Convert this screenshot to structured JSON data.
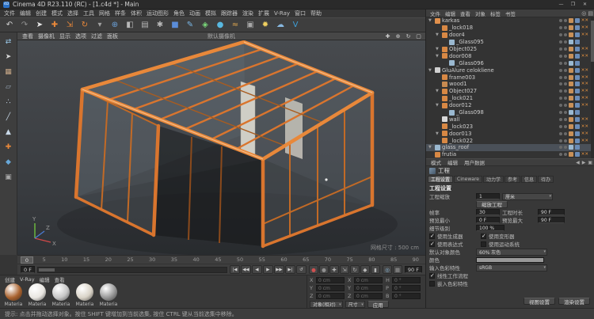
{
  "colors": {
    "accent": "#e8883a",
    "frame": "#d9752e",
    "frame_light": "#f8c89a",
    "panel": "#383838"
  },
  "title_bar": {
    "app_icon": "4D",
    "title": "Cinema 4D R23.110 (RC) - [1.c4d *] - Main",
    "minimize": "—",
    "maximize": "❐",
    "close": "✕"
  },
  "menu_bar": {
    "items": [
      "文件",
      "编辑",
      "创建",
      "模式",
      "选择",
      "工具",
      "网格",
      "样条",
      "体积",
      "运动图形",
      "角色",
      "动画",
      "模拟",
      "跟踪器",
      "渲染",
      "扩展",
      "V-Ray",
      "窗口",
      "帮助"
    ]
  },
  "toolbar": {
    "icons": [
      {
        "name": "undo-button",
        "glyph": "↶",
        "color": "#d0d0d0"
      },
      {
        "name": "redo-button",
        "glyph": "↷",
        "color": "#8f8f8f"
      },
      {
        "name": "live-selection-tool",
        "glyph": "➤",
        "color": "#e8e8e8"
      },
      {
        "name": "move-tool",
        "glyph": "✚",
        "color": "#e8883a"
      },
      {
        "name": "scale-tool",
        "glyph": "⇲",
        "color": "#e8883a"
      },
      {
        "name": "rotate-tool",
        "glyph": "↻",
        "color": "#e8883a"
      },
      {
        "name": "last-tool",
        "glyph": "▾",
        "color": "#a0a0a0"
      },
      {
        "name": "coordinate-system-toggle",
        "glyph": "⊕",
        "color": "#6aa0d8"
      },
      {
        "name": "render-view-button",
        "glyph": "◧",
        "color": "#b8b8b8"
      },
      {
        "name": "render-picture-viewer-button",
        "glyph": "▤",
        "color": "#b8b8b8"
      },
      {
        "name": "render-settings-button",
        "glyph": "✱",
        "color": "#b8b8b8"
      },
      {
        "name": "add-cube-button",
        "glyph": "■",
        "color": "#5b8dd9"
      },
      {
        "name": "add-spline-button",
        "glyph": "✎",
        "color": "#7ab8e8"
      },
      {
        "name": "mograph-menu-button",
        "glyph": "◈",
        "color": "#7ad87a"
      },
      {
        "name": "volume-menu-button",
        "glyph": "●",
        "color": "#58b8e0"
      },
      {
        "name": "simulate-menu-button",
        "glyph": "≈",
        "color": "#e0a850"
      },
      {
        "name": "add-camera-button",
        "glyph": "▣",
        "color": "#a8a8a8"
      },
      {
        "name": "add-light-button",
        "glyph": "✹",
        "color": "#f0d060"
      },
      {
        "name": "add-sky-button",
        "glyph": "☁",
        "color": "#88b8e0"
      },
      {
        "name": "vray-button",
        "glyph": "V",
        "color": "#3f9fd8"
      }
    ]
  },
  "left_toolbar": {
    "icons": [
      {
        "name": "make-editable-button",
        "glyph": "⇄",
        "color": "#9ac8e8"
      },
      {
        "name": "model-mode-button",
        "glyph": "➤",
        "color": "#d8d8d8"
      },
      {
        "name": "texture-mode-button",
        "glyph": "▦",
        "color": "#c8a888"
      },
      {
        "name": "workplane-mode-button",
        "glyph": "▱",
        "color": "#98a8b8"
      },
      {
        "name": "points-mode-button",
        "glyph": "∴",
        "color": "#c8d8e8"
      },
      {
        "name": "edges-mode-button",
        "glyph": "╱",
        "color": "#c8d8e8"
      },
      {
        "name": "polygons-mode-button",
        "glyph": "▲",
        "color": "#c8d8e8"
      },
      {
        "name": "enable-axis-button",
        "glyph": "✚",
        "color": "#e8883a"
      },
      {
        "name": "snap-toggle-button",
        "glyph": "◆",
        "color": "#68a8d8"
      },
      {
        "name": "lock-workplane-button",
        "glyph": "▣",
        "color": "#a8a8a8"
      }
    ]
  },
  "viewport": {
    "menus": [
      "查看",
      "摄像机",
      "显示",
      "选项",
      "过滤",
      "面板"
    ],
    "view_label": "默认摄像机",
    "nav_icons": [
      {
        "name": "pan-view-icon",
        "glyph": "✚"
      },
      {
        "name": "zoom-view-icon",
        "glyph": "⊕"
      },
      {
        "name": "rotate-view-icon",
        "glyph": "↻"
      },
      {
        "name": "toggle-view-icon",
        "glyph": "▢"
      }
    ],
    "grid_label": "网格尺寸 : 500 cm",
    "axis_labels": {
      "x": "X",
      "y": "Y",
      "z": "Z"
    }
  },
  "timeline": {
    "marker": "0",
    "ticks": [
      "0",
      "5",
      "10",
      "15",
      "20",
      "25",
      "30",
      "35",
      "40",
      "45",
      "50",
      "55",
      "60",
      "65",
      "70",
      "75",
      "80",
      "85",
      "90"
    ]
  },
  "transport": {
    "current_frame": "0 F",
    "end_frame": "90 F",
    "buttons": [
      {
        "name": "goto-start-button",
        "glyph": "|◀"
      },
      {
        "name": "prev-key-button",
        "glyph": "◀◀"
      },
      {
        "name": "prev-frame-button",
        "glyph": "◀"
      },
      {
        "name": "play-button",
        "glyph": "▶"
      },
      {
        "name": "next-frame-button",
        "glyph": "▶▶"
      },
      {
        "name": "next-key-button",
        "glyph": "▶|"
      },
      {
        "name": "loop-button",
        "glyph": "↺"
      }
    ],
    "record_buttons": [
      {
        "name": "record-keyframe-button",
        "glyph": "●",
        "color": "#d05050"
      },
      {
        "name": "autokey-toggle-button",
        "glyph": "●",
        "color": "#909090"
      },
      {
        "name": "record-position-toggle",
        "glyph": "✚",
        "color": "#b8b8b8"
      },
      {
        "name": "record-scale-toggle",
        "glyph": "⇲",
        "color": "#b8b8b8"
      },
      {
        "name": "record-rotation-toggle",
        "glyph": "↻",
        "color": "#b8b8b8"
      },
      {
        "name": "record-parameter-toggle",
        "glyph": "◆",
        "color": "#b8b8b8"
      },
      {
        "name": "record-pla-toggle",
        "glyph": "▮",
        "color": "#b8b8b8"
      }
    ],
    "misc_buttons": [
      {
        "name": "solo-toggle-button",
        "glyph": "◎",
        "color": "#88b8d8"
      },
      {
        "name": "timeline-options-button",
        "glyph": "▦",
        "color": "#9a9a9a"
      }
    ]
  },
  "materials": {
    "menus": [
      "创建",
      "V-Ray",
      "编辑",
      "查看"
    ],
    "items": [
      {
        "name": "Materia",
        "color": "#a9622e"
      },
      {
        "name": "Materia",
        "color": "#e9e6e1"
      },
      {
        "name": "Materia",
        "color": "#c6c6c6"
      },
      {
        "name": "Materia",
        "color": "#d9d3c7"
      },
      {
        "name": "Materia",
        "color": "#979797"
      }
    ]
  },
  "coordinates": {
    "pos": {
      "x_label": "X",
      "x": "0 cm",
      "y_label": "Y",
      "y": "0 cm",
      "z_label": "Z",
      "z": "0 cm"
    },
    "size": {
      "x_label": "X",
      "x": "0 cm",
      "y_label": "Y",
      "y": "0 cm",
      "z_label": "Z",
      "z": "0 cm"
    },
    "rot": {
      "h_label": "H",
      "h": "0 °",
      "p_label": "P",
      "p": "0 °",
      "b_label": "B",
      "b": "0 °"
    },
    "mode": "对象(相对)",
    "size_mode": "尺寸",
    "apply": "应用"
  },
  "object_manager": {
    "menus": [
      "文件",
      "编辑",
      "查看",
      "对象",
      "标签",
      "书签"
    ],
    "menu_icons": [
      {
        "name": "om-search-icon",
        "glyph": "◎"
      },
      {
        "name": "om-filter-icon",
        "glyph": "▤"
      }
    ],
    "objects": [
      {
        "name": "karkas",
        "indent": 0,
        "caret": true,
        "icon": "#e0904c",
        "tag1": "#c89058",
        "tag2": "#6a8cb8",
        "x": true,
        "selected": false
      },
      {
        "name": "_lock018",
        "indent": 1,
        "caret": false,
        "icon": "#d88844",
        "tag1": "#c89058",
        "tag2": "#6a8cb8",
        "x": true,
        "selected": false
      },
      {
        "name": "door4",
        "indent": 1,
        "caret": true,
        "icon": "#d88844",
        "tag1": "#c89058",
        "tag2": "#6a8cb8",
        "x": true,
        "selected": false
      },
      {
        "name": "_Glass095",
        "indent": 2,
        "caret": false,
        "icon": "#9ab8d0",
        "tag1": "#9ab8d0",
        "tag2": "#6a8cb8",
        "x": false,
        "selected": false
      },
      {
        "name": "Object025",
        "indent": 1,
        "caret": true,
        "icon": "#d88844",
        "tag1": "#c89058",
        "tag2": "#6a8cb8",
        "x": true,
        "selected": false
      },
      {
        "name": "door008",
        "indent": 1,
        "caret": true,
        "icon": "#d88844",
        "tag1": "#c89058",
        "tag2": "#6a8cb8",
        "x": true,
        "selected": false
      },
      {
        "name": "_Glass096",
        "indent": 2,
        "caret": false,
        "icon": "#9ab8d0",
        "tag1": "#9ab8d0",
        "tag2": "#6a8cb8",
        "x": false,
        "selected": false
      },
      {
        "name": "GluAlure celokliene",
        "indent": 0,
        "caret": true,
        "icon": "#d0d0d0",
        "tag1": "#c89058",
        "tag2": "#6a8cb8",
        "x": true,
        "selected": false
      },
      {
        "name": "frame003",
        "indent": 1,
        "caret": false,
        "icon": "#d88844",
        "tag1": "#c89058",
        "tag2": "#6a8cb8",
        "x": true,
        "selected": false
      },
      {
        "name": "wood1",
        "indent": 1,
        "caret": false,
        "icon": "#c88a50",
        "tag1": "#c89058",
        "tag2": "#6a8cb8",
        "x": true,
        "selected": false
      },
      {
        "name": "Object027",
        "indent": 1,
        "caret": true,
        "icon": "#d88844",
        "tag1": "#c89058",
        "tag2": "#6a8cb8",
        "x": true,
        "selected": false
      },
      {
        "name": "_lock021",
        "indent": 1,
        "caret": false,
        "icon": "#d88844",
        "tag1": "#c89058",
        "tag2": "#6a8cb8",
        "x": true,
        "selected": false
      },
      {
        "name": "door012",
        "indent": 1,
        "caret": true,
        "icon": "#d88844",
        "tag1": "#c89058",
        "tag2": "#6a8cb8",
        "x": true,
        "selected": false
      },
      {
        "name": "_Glass098",
        "indent": 2,
        "caret": false,
        "icon": "#9ab8d0",
        "tag1": "#9ab8d0",
        "tag2": "#6a8cb8",
        "x": false,
        "selected": false
      },
      {
        "name": "wall",
        "indent": 1,
        "caret": false,
        "icon": "#d8d8d8",
        "tag1": "#c89058",
        "tag2": "#6a8cb8",
        "x": true,
        "selected": false
      },
      {
        "name": "_lock023",
        "indent": 1,
        "caret": false,
        "icon": "#d88844",
        "tag1": "#c89058",
        "tag2": "#6a8cb8",
        "x": true,
        "selected": false
      },
      {
        "name": "door013",
        "indent": 1,
        "caret": true,
        "icon": "#d88844",
        "tag1": "#c89058",
        "tag2": "#6a8cb8",
        "x": true,
        "selected": false
      },
      {
        "name": "_lock022",
        "indent": 1,
        "caret": false,
        "icon": "#d88844",
        "tag1": "#c89058",
        "tag2": "#6a8cb8",
        "x": true,
        "selected": false
      },
      {
        "name": "glass_roof",
        "indent": 0,
        "caret": true,
        "icon": "#9ab8d0",
        "tag1": "#9ab8d0",
        "tag2": "#6a8cb8",
        "x": false,
        "selected": true
      },
      {
        "name": "frutia",
        "indent": 0,
        "caret": false,
        "icon": "#d88844",
        "tag1": "#c89058",
        "tag2": "#6a8cb8",
        "x": true,
        "selected": false
      }
    ]
  },
  "attribute_manager": {
    "tabs": [
      "模式",
      "编辑",
      "用户数据"
    ],
    "tab_icons": [
      "◀",
      "▶",
      "▣"
    ],
    "title": "工程",
    "sub_tabs": [
      {
        "label": "工程设置",
        "active": true
      },
      {
        "label": "Cineware",
        "active": false
      },
      {
        "label": "动力学",
        "active": false
      },
      {
        "label": "参考",
        "active": false
      },
      {
        "label": "信息",
        "active": false
      },
      {
        "label": "待办",
        "active": false
      }
    ],
    "section": "工程设置",
    "fields": {
      "scale_label": "工程缩放",
      "scale_value": "1",
      "scale_unit": "厘米",
      "scale_button": "缩放工程",
      "fps_label": "帧率",
      "fps_value": "30",
      "duration_label": "工程时长",
      "duration_value": "90 F",
      "preview_min_label": "预览最小",
      "preview_min_value": "0 F",
      "preview_max_label": "预览最大",
      "preview_max_value": "90 F",
      "lod_label": "细节级别",
      "lod_value": "100 %",
      "use_generators_label": "使用生成器",
      "use_generators_checked": true,
      "use_deformers_label": "使用变形器",
      "use_deformers_checked": true,
      "use_expressions_label": "使用表达式",
      "use_expressions_checked": true,
      "use_motion_label": "使用运动系统",
      "use_motion_checked": false,
      "default_color_label": "默认对象颜色",
      "default_color_value": "60% 灰色",
      "color_label": "颜色",
      "color_swatch": "#999999",
      "input_profile_label": "输入色彩特性",
      "input_profile_value": "sRGB",
      "linear_workflow_label": "线性工作流程",
      "linear_workflow_checked": true,
      "embed_profile_label": "嵌入色彩特性",
      "embed_profile_checked": false,
      "view_button": "视图设置",
      "render_button": "渲染设置"
    }
  },
  "status_bar": {
    "hint": "提示: 点击并拖动选择对象。按住 SHIFT 键增加到当前选集, 按住 CTRL 键从当前选集中移除。"
  }
}
